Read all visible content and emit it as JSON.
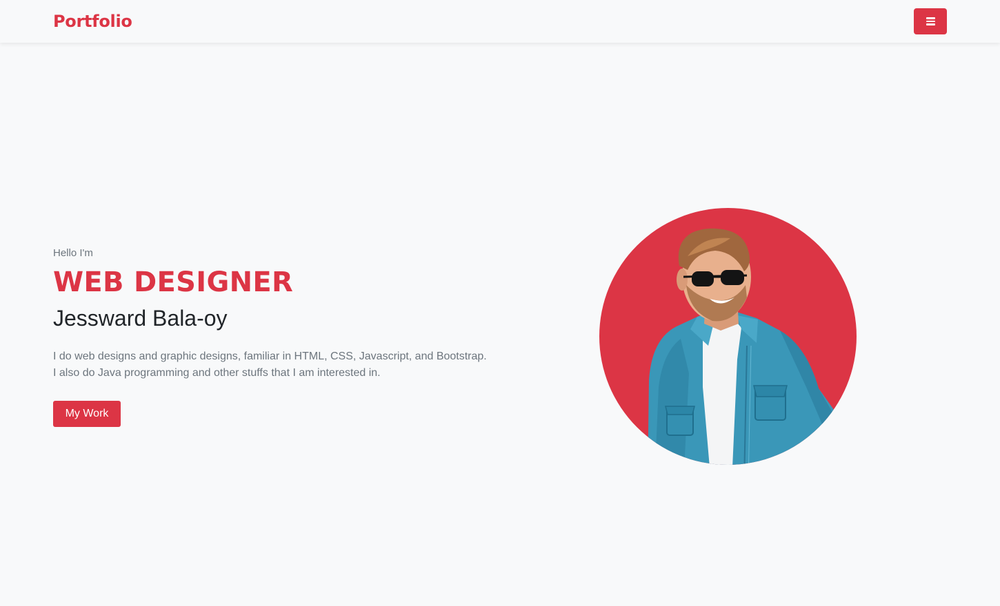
{
  "navbar": {
    "brand": "Portfolio",
    "menu_icon": "hamburger-menu-icon"
  },
  "hero": {
    "greeting": "Hello I'm",
    "role": "WEB DESIGNER",
    "name": "Jessward Bala-oy",
    "bio": "I do web designs and graphic designs, familiar in HTML, CSS, Javascript, and Bootstrap. I also do Java programming and other stuffs that I am interested in.",
    "cta_label": "My Work"
  },
  "colors": {
    "accent": "#dc3545",
    "background": "#f8f9fa",
    "muted_text": "#6c757d",
    "heading_text": "#212529"
  }
}
